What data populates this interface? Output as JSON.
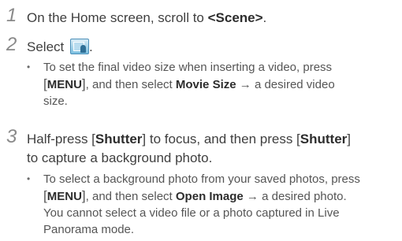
{
  "steps": [
    {
      "number": "1",
      "text_prefix": "On the Home screen, scroll to ",
      "text_bold": "<Scene>",
      "text_suffix": "."
    },
    {
      "number": "2",
      "text_prefix": "Select ",
      "icon": "scene-frame-icon",
      "text_suffix": ".",
      "bullet": {
        "part1": "To set the final video size when inserting a video, press",
        "bracket_open": "[",
        "menu": "MENU",
        "bracket_close": "]",
        "part2": ", and then select ",
        "bold": "Movie Size",
        "arrow": " → ",
        "part3": "a desired video",
        "part4": "size."
      }
    },
    {
      "number": "3",
      "line1_a": "Half-press [",
      "line1_b": "Shutter",
      "line1_c": "] to focus, and then press [",
      "line1_d": "Shutter",
      "line1_e": "]",
      "line2": "to capture a background photo.",
      "bullet": {
        "part1": "To select a background photo from your saved photos, press",
        "bracket_open": "[",
        "menu": "MENU",
        "bracket_close": "]",
        "part2": ", and then select ",
        "bold": "Open Image",
        "arrow": " → ",
        "part3": "a desired photo.",
        "line3": "You cannot select a video file or a photo captured in Live",
        "line4": "Panorama mode."
      }
    }
  ]
}
